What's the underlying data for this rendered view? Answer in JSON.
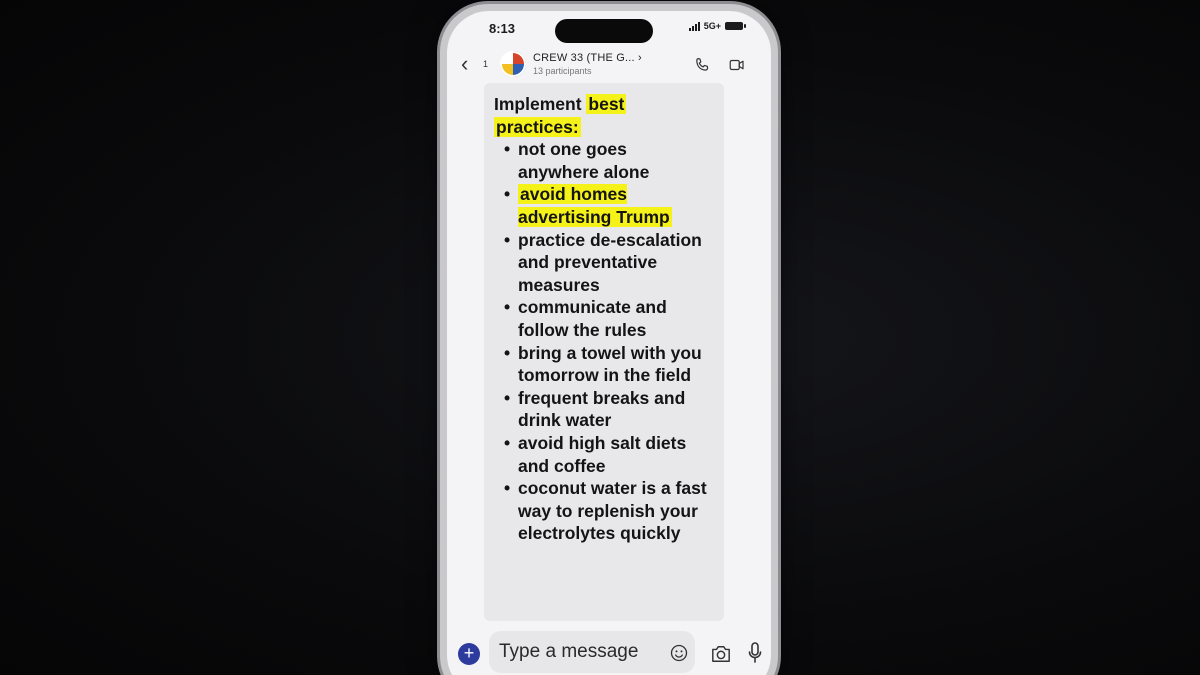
{
  "status_bar": {
    "time": "8:13",
    "network": "5G+"
  },
  "header": {
    "back_count": "1",
    "title": "CREW 33 (THE G... ›",
    "subtitle": "13 participants"
  },
  "message": {
    "heading_plain": "Implement ",
    "heading_highlight_1": "best",
    "heading_highlight_2": "practices:",
    "items": [
      "not one goes anywhere alone",
      "avoid homes advertising Trump",
      "practice de-escalation and preventative measures",
      "communicate and follow the rules",
      "bring a towel with you tomorrow in the field",
      "frequent breaks and drink water",
      "avoid high salt diets and coffee",
      "coconut water is a fast way to replenish your electrolytes quickly"
    ],
    "highlighted_item_index": 1
  },
  "composer": {
    "placeholder": "Type a message",
    "plus_label": "+"
  },
  "colors": {
    "highlight": "#f5f21a",
    "accent": "#2d3a9e"
  },
  "icons": [
    "back-icon",
    "call-icon",
    "video-icon",
    "emoji-icon",
    "camera-icon",
    "mic-icon",
    "plus-icon"
  ]
}
